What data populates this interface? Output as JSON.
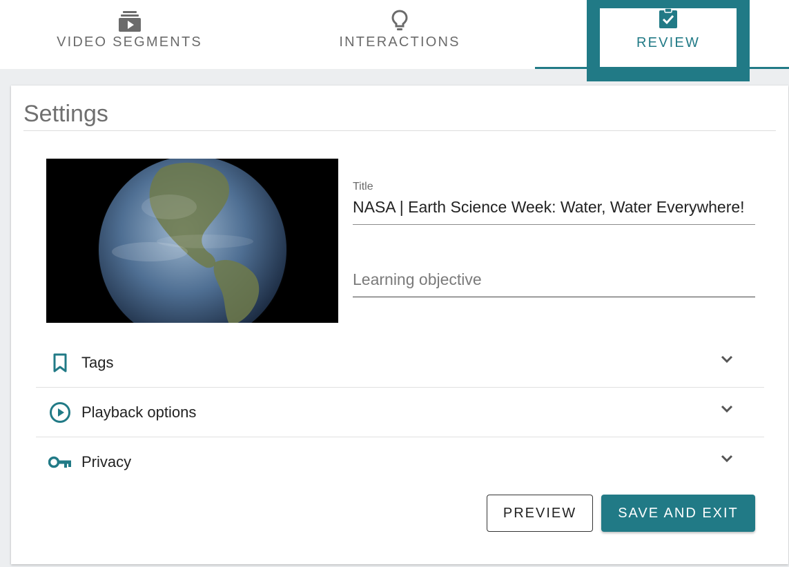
{
  "tabs": {
    "video_segments": {
      "label": "VIDEO SEGMENTS",
      "icon": "video-stack-icon"
    },
    "interactions": {
      "label": "INTERACTIONS",
      "icon": "lightbulb-icon"
    },
    "review": {
      "label": "REVIEW",
      "icon": "clipboard-check-icon",
      "active": true
    }
  },
  "settings": {
    "heading": "Settings",
    "title_label": "Title",
    "title_value": "NASA | Earth Science Week: Water, Water Everywhere!",
    "objective_placeholder": "Learning objective"
  },
  "accordion": [
    {
      "label": "Tags",
      "icon": "bookmark-icon"
    },
    {
      "label": "Playback options",
      "icon": "play-circle-icon"
    },
    {
      "label": "Privacy",
      "icon": "key-icon"
    }
  ],
  "buttons": {
    "preview": "PREVIEW",
    "save_exit": "SAVE AND EXIT"
  },
  "colors": {
    "accent": "#217a86",
    "tab_inactive": "#6b6b6b",
    "background": "#eceef0"
  }
}
